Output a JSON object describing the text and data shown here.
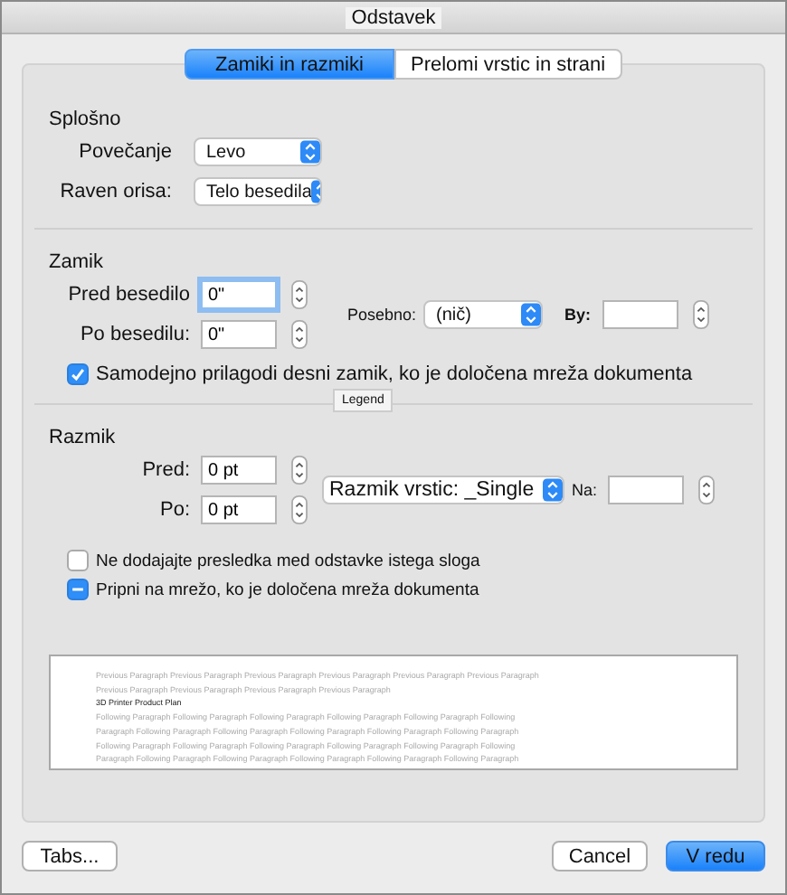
{
  "window": {
    "title": "Odstavek"
  },
  "tabs": [
    {
      "label": "Zamiki in razmiki",
      "selected": true
    },
    {
      "label": "Prelomi vrstic in strani",
      "selected": false
    }
  ],
  "general": {
    "heading": "Splošno",
    "fields": [
      {
        "label": "Povečanje",
        "value": "Levo"
      },
      {
        "label": "Raven orisa:",
        "value": "Telo besedila"
      }
    ]
  },
  "indent": {
    "heading": "Zamik",
    "fields": [
      {
        "label": "Pred besedilo",
        "value": "0\"",
        "focused": true
      },
      {
        "label": "Po besedilu:",
        "value": "0\"",
        "focused": false
      }
    ],
    "special": {
      "label": "Posebno:",
      "value": "(nič)"
    },
    "by": {
      "label": "By:"
    },
    "checkbox": {
      "label": "Samodejno prilagodi desni zamik, ko je določena mreža dokumenta",
      "checked": true
    }
  },
  "tooltip": "Legend",
  "spacing": {
    "heading": "Razmik",
    "fields": [
      {
        "label": "Pred:",
        "value": "0 pt",
        "focused": false
      },
      {
        "label": "Po:",
        "value": "0 pt",
        "focused": false
      }
    ],
    "line_spacing": {
      "label": "Razmik vrstic:",
      "value": "_Single"
    },
    "at": {
      "label": "Na:"
    },
    "checkboxes": [
      {
        "label": "Ne dodajajte presledka med odstavke istega sloga",
        "checked": false,
        "mixed": false
      },
      {
        "label": "Pripni na mrežo, ko je določena mreža dokumenta",
        "checked": true,
        "mixed": true
      }
    ]
  },
  "preview": {
    "previous_lines": [
      "Previous Paragraph Previous Paragraph Previous Paragraph Previous Paragraph Previous Paragraph Previous Paragraph",
      "Previous Paragraph Previous Paragraph Previous Paragraph Previous Paragraph"
    ],
    "heading": "3D Printer Product Plan",
    "following_lines": [
      "Following Paragraph Following Paragraph Following Paragraph Following Paragraph Following Paragraph Following",
      "Paragraph Following Paragraph Following Paragraph Following Paragraph Following Paragraph Following Paragraph",
      "Following Paragraph Following Paragraph Following Paragraph Following Paragraph Following Paragraph Following",
      "Paragraph Following Paragraph Following Paragraph Following Paragraph Following Paragraph Following Paragraph"
    ]
  },
  "buttons": [
    {
      "label": "Tabs...",
      "kind": "plain"
    },
    {
      "label": "Cancel",
      "kind": "plain"
    },
    {
      "label": "V redu",
      "kind": "default"
    }
  ]
}
